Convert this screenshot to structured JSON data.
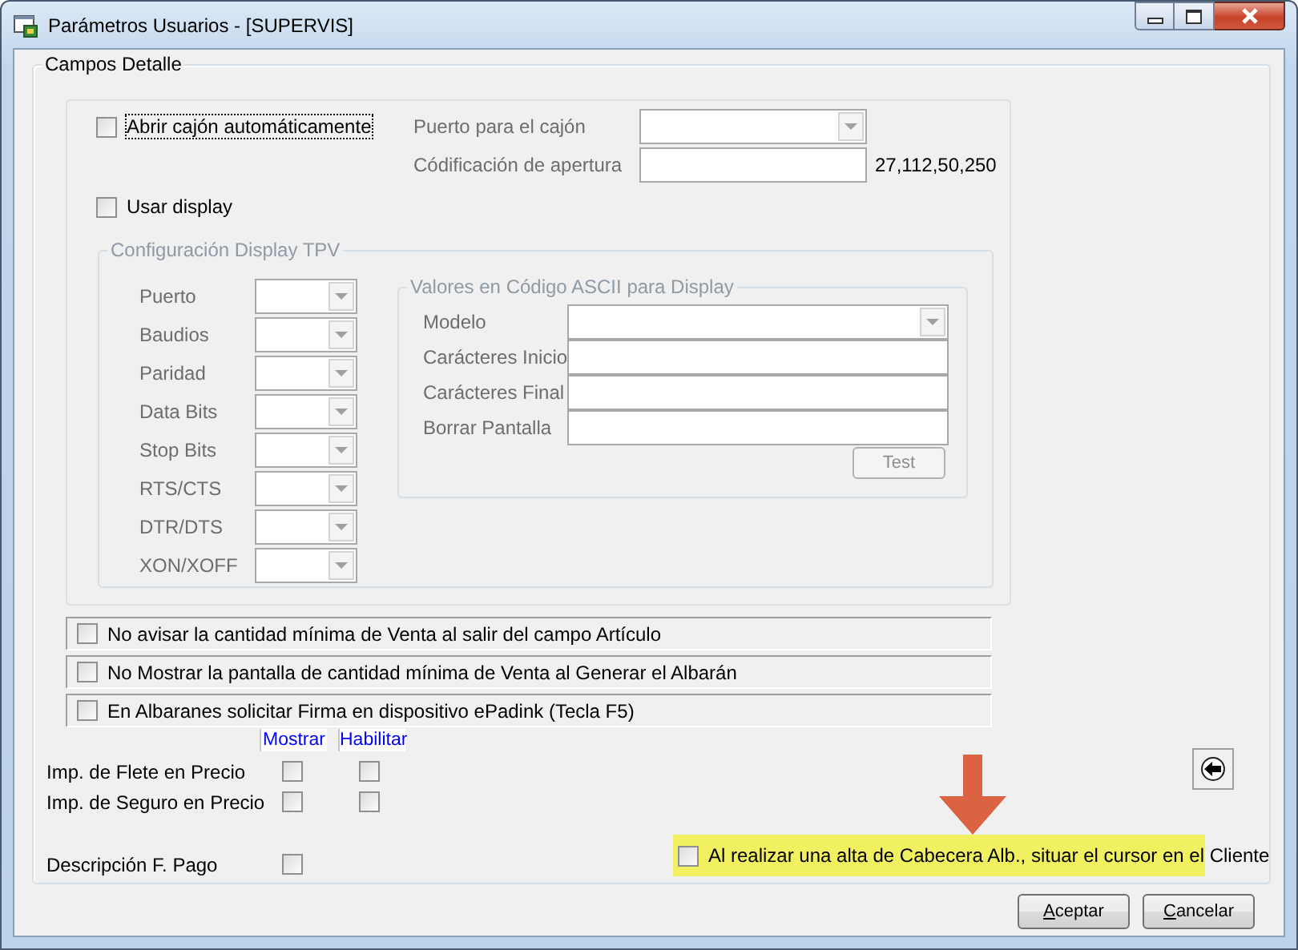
{
  "window": {
    "title": "Parámetros Usuarios - [SUPERVIS]"
  },
  "group": {
    "title": "Campos Detalle"
  },
  "drawer": {
    "checkbox": {
      "label": "Abrir cajón automáticamente",
      "checked": false,
      "focused": true
    },
    "fields": [
      {
        "label": "Puerto para el cajón",
        "kind": "combo",
        "disabled": true
      },
      {
        "label": "Códificación de apertura",
        "kind": "text",
        "disabled": true,
        "suffix": "27,112,50,250"
      }
    ]
  },
  "display": {
    "checkbox": {
      "label": "Usar display",
      "checked": false
    },
    "config": {
      "title": "Configuración Display TPV",
      "disabled": true,
      "ports": [
        {
          "label": "Puerto"
        },
        {
          "label": "Baudios"
        },
        {
          "label": "Paridad"
        },
        {
          "label": "Data Bits"
        },
        {
          "label": "Stop Bits"
        },
        {
          "label": "RTS/CTS"
        },
        {
          "label": "DTR/DTS"
        },
        {
          "label": "XON/XOFF"
        }
      ],
      "ascii": {
        "title": "Valores en Código ASCII para Display",
        "fields": [
          {
            "label": "Modelo",
            "kind": "combo"
          },
          {
            "label": "Carácteres Inicio",
            "kind": "text"
          },
          {
            "label": "Carácteres Final",
            "kind": "text"
          },
          {
            "label": "Borrar Pantalla",
            "kind": "text"
          }
        ],
        "test_button": {
          "label": "Test",
          "disabled": true
        }
      }
    }
  },
  "options": [
    {
      "label": "No avisar la cantidad mínima de Venta al salir del campo Artículo",
      "checked": false
    },
    {
      "label": "No Mostrar la pantalla de cantidad mínima de Venta al Generar el Albarán",
      "checked": false
    },
    {
      "label": "En Albaranes solicitar Firma en dispositivo ePadink (Tecla F5)",
      "checked": false
    }
  ],
  "matrix": {
    "columns": [
      "Mostrar",
      "Habilitar"
    ],
    "rows": [
      {
        "label": "Imp. de Flete en Precio",
        "show": false,
        "enable": false
      },
      {
        "label": "Imp. de Seguro en Precio",
        "show": false,
        "enable": false
      }
    ]
  },
  "payment": {
    "label": "Descripción F. Pago",
    "checked": false
  },
  "highlight": {
    "label": "Al realizar una alta de Cabecera Alb., situar el cursor en el Cliente",
    "checked": false,
    "highlighted": true
  },
  "buttons": [
    {
      "access_key": "A",
      "label_rest": "ceptar"
    },
    {
      "access_key": "C",
      "label_rest": "ancelar"
    }
  ]
}
